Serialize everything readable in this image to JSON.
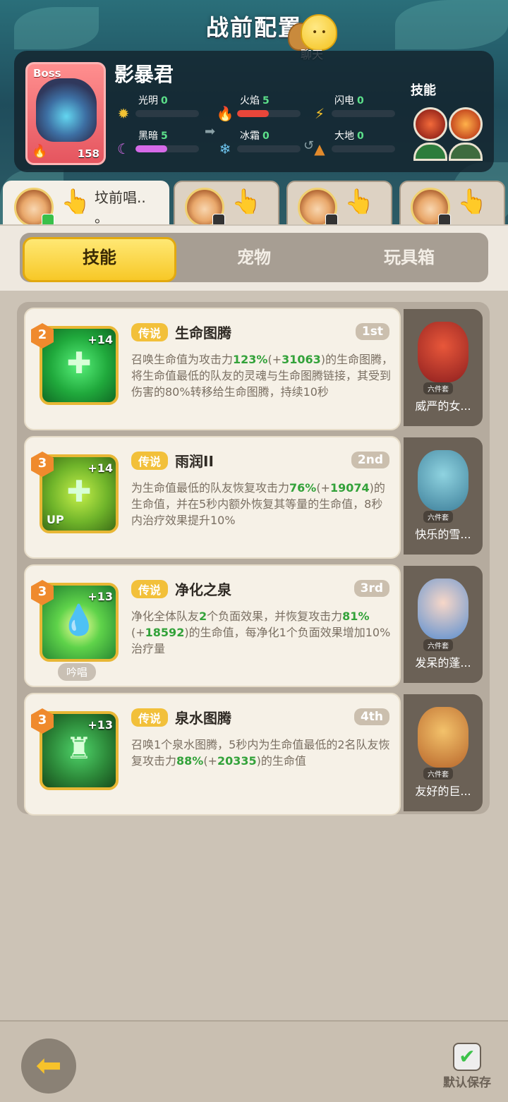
{
  "header": {
    "title": "战前配置",
    "chat_label": "聊天"
  },
  "boss": {
    "tag": "Boss",
    "name": "影暴君",
    "level": "158",
    "skills_label": "技能",
    "stats": [
      {
        "label": "光明",
        "value": "0",
        "icon": "sun-icon",
        "color": "#f2c233",
        "fill": 0
      },
      {
        "label": "火焰",
        "value": "5",
        "icon": "flame-icon",
        "color": "#e8463a",
        "fill": 0.5
      },
      {
        "label": "闪电",
        "value": "0",
        "icon": "lightning-icon",
        "color": "#f6c22b",
        "fill": 0
      },
      {
        "label": "黑暗",
        "value": "5",
        "icon": "moon-icon",
        "color": "#d56ae8",
        "fill": 0.5
      },
      {
        "label": "冰霜",
        "value": "0",
        "icon": "snowflake-icon",
        "color": "#6fc6f0",
        "fill": 0
      },
      {
        "label": "大地",
        "value": "0",
        "icon": "mountain-icon",
        "color": "#e28a2c",
        "fill": 0
      }
    ]
  },
  "build_tabs": [
    {
      "label": "坟前唱..\n。",
      "active": true
    },
    {
      "label": "",
      "active": false
    },
    {
      "label": "",
      "active": false
    },
    {
      "label": "",
      "active": false
    }
  ],
  "segments": [
    "技能",
    "宠物",
    "玩具箱"
  ],
  "skills": [
    {
      "level": "2",
      "plus": "+14",
      "rarity": "传说",
      "name": "生命图腾",
      "rank": "1st",
      "desc_parts": [
        "召唤生命值为攻击力",
        "123%",
        "(+",
        "31063",
        ")的生命图腾，将生命值最低的队友的灵魂与生命图腾链接，其受到伤害的80%转移给生命图腾，持续10秒"
      ],
      "pet_name": "威严的女...",
      "pet_set": "六件套"
    },
    {
      "level": "3",
      "plus": "+14",
      "rarity": "传说",
      "name": "雨润II",
      "rank": "2nd",
      "up": "UP",
      "desc_parts": [
        "为生命值最低的队友恢复攻击力",
        "76%",
        "(+",
        "19074",
        ")的生命值，并在5秒内额外恢复其等量的生命值，8秒内治疗效果提升10%"
      ],
      "pet_name": "快乐的雪...",
      "pet_set": "六件套"
    },
    {
      "level": "3",
      "plus": "+13",
      "rarity": "传说",
      "name": "净化之泉",
      "rank": "3rd",
      "chant": "吟唱",
      "desc_parts": [
        "净化全体队友",
        "2",
        "个负面效果，并恢复攻击力",
        "81%",
        "(+",
        "18592",
        ")的生命值，每净化1个负面效果增加10%治疗量"
      ],
      "pet_name": "发呆的蓬...",
      "pet_set": "六件套"
    },
    {
      "level": "3",
      "plus": "+13",
      "rarity": "传说",
      "name": "泉水图腾",
      "rank": "4th",
      "desc_parts": [
        "召唤1个泉水图腾，5秒内为生命值最低的2名队友恢复攻击力",
        "88%",
        "(+",
        "20335",
        ")的生命值"
      ],
      "pet_name": "友好的巨...",
      "pet_set": "六件套"
    }
  ],
  "bottom": {
    "save_label": "默认保存"
  }
}
